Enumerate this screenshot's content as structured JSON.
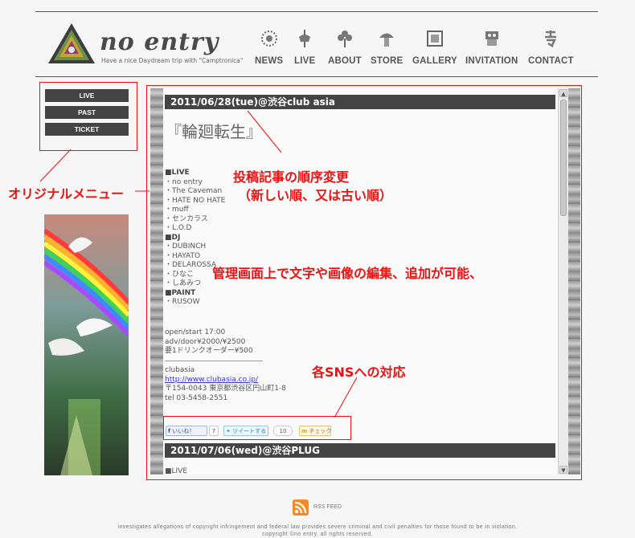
{
  "brand": {
    "logo_text": "no entry",
    "tagline": "Have a nice Daydream trip with \"Camptronica\""
  },
  "nav": [
    {
      "label": "NEWS",
      "icon": "gear-flower-icon"
    },
    {
      "label": "LIVE",
      "icon": "carousel-horse-icon"
    },
    {
      "label": "ABOUT",
      "icon": "clover-icon"
    },
    {
      "label": "STORE",
      "icon": "mushroom-icon"
    },
    {
      "label": "GALLERY",
      "icon": "picture-frame-icon"
    },
    {
      "label": "INVITATION",
      "icon": "robot-icon"
    },
    {
      "label": "CONTACT",
      "icon": "kanji-icon"
    }
  ],
  "menu": {
    "live": "LIVE",
    "past": "PAST",
    "ticket": "TICKET"
  },
  "annotations": {
    "menu": "オリジナルメニュー",
    "order_line1": "投稿記事の順序変更",
    "order_line2": "（新しい順、又は古い順）",
    "edit": "管理画面上で文字や画像の編集、追加が可能、",
    "sns": "各SNSへの対応"
  },
  "post1": {
    "header": "2011/06/28(tue)@渋谷club asia",
    "title": "『輪廻転生』",
    "live_heading": "■LIVE",
    "live": [
      "・no entry",
      "・The Caveman",
      "・HATE NO HATE",
      "・muff",
      "・センカラス",
      "・L.O.D"
    ],
    "dj_heading": "■DJ",
    "dj": [
      "・DUBINCH",
      "・HAYATO",
      "・DELAROSSA",
      "・ひなこ",
      "・しあみつ"
    ],
    "paint_heading": "■PAINT",
    "paint": [
      "・RUSOW"
    ],
    "open": "open/start 17:00",
    "door": "adv/door¥2000/¥2500",
    "drink": "要1ドリンクオーダー¥500",
    "venue": "clubasia",
    "url": "http://www.clubasia.co.jp/",
    "address": "〒154-0043 東京都渋谷区円山町1-8",
    "tel": "tel 03-5458-2551"
  },
  "sns": {
    "like": "いいね！",
    "like_count": "7",
    "tweet": "ツイートする",
    "tweet_count": "10",
    "mixi": "チェック"
  },
  "post2": {
    "header": "2011/07/06(wed)@渋谷PLUG",
    "first_line": "■LIVE"
  },
  "rss": "RSS FEED",
  "footer": {
    "line1": "investigates allegations of copyright infringement and federal law provides severe criminal and civil penalties for those found to be in violation.",
    "line2": "copyright ©no entry. all rights reserved."
  },
  "colors": {
    "accent": "#e11111",
    "header_bar": "#444444",
    "link": "#3333cc"
  }
}
